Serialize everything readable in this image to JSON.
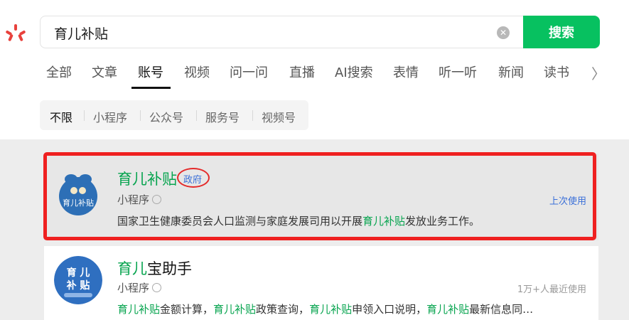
{
  "search": {
    "query": "育儿补贴",
    "button_label": "搜索"
  },
  "tabs": [
    {
      "label": "全部"
    },
    {
      "label": "文章"
    },
    {
      "label": "账号"
    },
    {
      "label": "视频"
    },
    {
      "label": "问一问"
    },
    {
      "label": "直播"
    },
    {
      "label": "AI搜索"
    },
    {
      "label": "表情"
    },
    {
      "label": "听一听"
    },
    {
      "label": "新闻"
    },
    {
      "label": "读书"
    }
  ],
  "active_tab": "账号",
  "filters": [
    {
      "label": "不限"
    },
    {
      "label": "小程序"
    },
    {
      "label": "公众号"
    },
    {
      "label": "服务号"
    },
    {
      "label": "视频号"
    }
  ],
  "active_filter": "不限",
  "results": [
    {
      "title_highlight": "育儿补贴",
      "title_rest": "",
      "badge": "政府",
      "type": "小程序",
      "right_text": "上次使用",
      "right_color": "#3a6fd8",
      "desc_parts": [
        {
          "text": "国家卫生健康委员会人口监测与家庭发展司用以开展",
          "hl": false
        },
        {
          "text": "育儿补贴",
          "hl": true
        },
        {
          "text": "发放业务工作。",
          "hl": false
        }
      ],
      "avatar_text": "育儿补贴"
    },
    {
      "title_highlight": "育儿",
      "title_rest": "宝助手",
      "type": "小程序",
      "right_text": "1万+人最近使用",
      "right_color": "#999999",
      "desc_parts": [
        {
          "text": "育儿补贴",
          "hl": true
        },
        {
          "text": "金额计算，",
          "hl": false
        },
        {
          "text": "育儿补贴",
          "hl": true
        },
        {
          "text": "政策查询，",
          "hl": false
        },
        {
          "text": "育儿补贴",
          "hl": true
        },
        {
          "text": "申领入口说明，",
          "hl": false
        },
        {
          "text": "育儿补贴",
          "hl": true
        },
        {
          "text": "最新信息同…",
          "hl": false
        }
      ],
      "avatar_line1": "育 儿",
      "avatar_line2": "补 贴"
    }
  ],
  "colors": {
    "accent": "#07c160",
    "highlight_text": "#07a44f",
    "badge_blue": "#3a6fd8",
    "annotation_red": "#ef2020"
  },
  "icons": [
    "sparkle-logo-icon",
    "clear-icon",
    "chevron-right-icon",
    "mini-program-icon"
  ]
}
